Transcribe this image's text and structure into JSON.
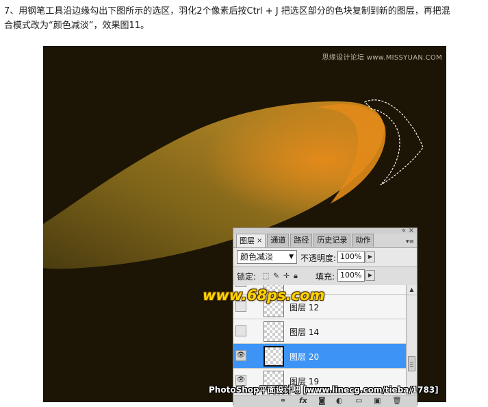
{
  "instruction": {
    "line1": "7、用钢笔工具沿边缘勾出下图所示的选区，羽化2个像素后按Ctrl + J 把选区部分的色块复制到新的图层，再把混",
    "line2": "合模式改为“颜色减淡”，效果图11。"
  },
  "canvas": {
    "watermark_top_right": "思缘设计论坛 www.MISSYUAN.COM",
    "watermark_68ps": "www.68ps.com",
    "watermark_bottom": "PhotoShop平面设计吧 [www.linecg.com/tieba/1783]",
    "background_color": "#1c1505",
    "shape_colors": {
      "dark": "#5c4a12",
      "mid": "#a67d22",
      "tip": "#e3901a"
    }
  },
  "layers_panel": {
    "tabs": [
      {
        "label": "图层",
        "active": true,
        "closable": true
      },
      {
        "label": "通道"
      },
      {
        "label": "路径"
      },
      {
        "label": "历史记录"
      },
      {
        "label": "动作"
      }
    ],
    "blend_mode": "颜色减淡",
    "opacity_label": "不透明度:",
    "opacity_value": "100%",
    "lock_label": "锁定:",
    "fill_label": "填充:",
    "fill_value": "100%",
    "layers": [
      {
        "name": "",
        "visible": false,
        "selected": false
      },
      {
        "name": "图层 12",
        "visible": false,
        "selected": false
      },
      {
        "name": "图层 14",
        "visible": false,
        "selected": false
      },
      {
        "name": "图层 20",
        "visible": true,
        "selected": true
      },
      {
        "name": "图层 19",
        "visible": true,
        "selected": false
      }
    ],
    "bottom_icons": [
      "link-icon",
      "fx-icon",
      "mask-icon",
      "adjustment-icon",
      "group-icon",
      "new-layer-icon",
      "delete-icon"
    ],
    "selection_color": "#3d94f6"
  }
}
